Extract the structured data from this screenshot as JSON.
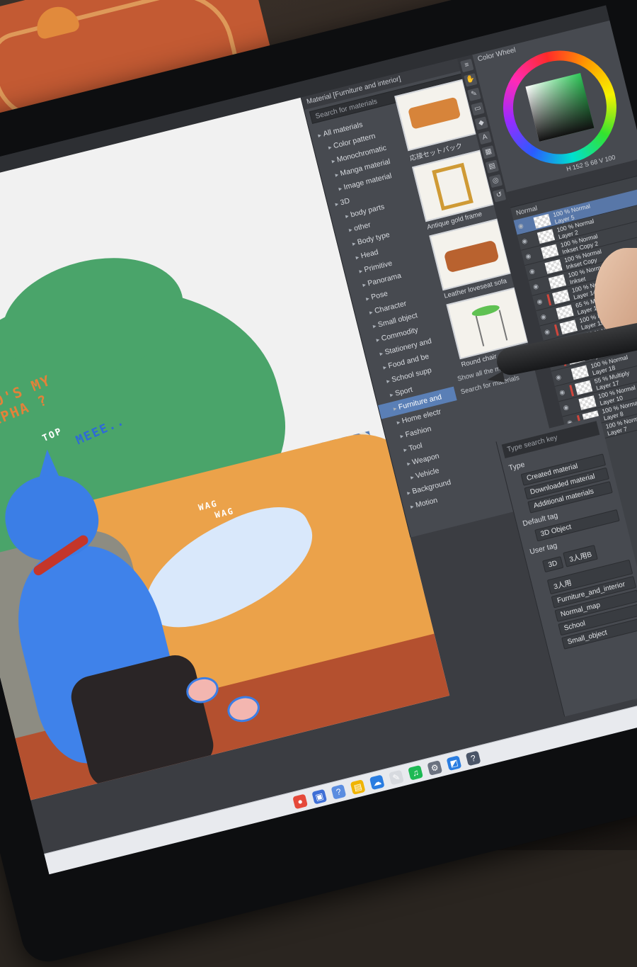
{
  "canvas_text": {
    "line1": "WHO'S MY",
    "line2": "ALPHA ?",
    "top": "TOP",
    "meee": "MEEE..",
    "wag1": "WAG",
    "wag2": "WAG"
  },
  "material_panel": {
    "title": "Material [Furniture and interior]",
    "search_placeholder": "Search for materials",
    "tree": [
      {
        "label": "All materials",
        "icon": "folder-icon",
        "level": 1,
        "selected": false
      },
      {
        "label": "Color pattern",
        "icon": "folder-icon",
        "level": 2,
        "selected": false
      },
      {
        "label": "Monochromatic",
        "icon": "folder-icon",
        "level": 2,
        "selected": false
      },
      {
        "label": "Manga material",
        "icon": "folder-icon",
        "level": 2,
        "selected": false
      },
      {
        "label": "Image material",
        "icon": "folder-icon",
        "level": 2,
        "selected": false
      },
      {
        "label": "3D",
        "icon": "folder-icon",
        "level": 1,
        "selected": false
      },
      {
        "label": "body parts",
        "icon": "folder-icon",
        "level": 2,
        "selected": false
      },
      {
        "label": "other",
        "icon": "folder-icon",
        "level": 2,
        "selected": false
      },
      {
        "label": "Body type",
        "icon": "folder-icon",
        "level": 2,
        "selected": false
      },
      {
        "label": "Head",
        "icon": "folder-icon",
        "level": 2,
        "selected": false
      },
      {
        "label": "Primitive",
        "icon": "folder-icon",
        "level": 2,
        "selected": false
      },
      {
        "label": "Panorama",
        "icon": "folder-icon",
        "level": 2,
        "selected": false
      },
      {
        "label": "Pose",
        "icon": "folder-icon",
        "level": 2,
        "selected": false
      },
      {
        "label": "Character",
        "icon": "folder-icon",
        "level": 2,
        "selected": false
      },
      {
        "label": "Small object",
        "icon": "folder-icon",
        "level": 2,
        "selected": false
      },
      {
        "label": "Commodity",
        "icon": "folder-icon",
        "level": 2,
        "selected": false
      },
      {
        "label": "Stationery and",
        "icon": "folder-icon",
        "level": 2,
        "selected": false
      },
      {
        "label": "Food and be",
        "icon": "folder-icon",
        "level": 2,
        "selected": false
      },
      {
        "label": "School supp",
        "icon": "folder-icon",
        "level": 2,
        "selected": false
      },
      {
        "label": "Sport",
        "icon": "folder-icon",
        "level": 2,
        "selected": false
      },
      {
        "label": "Furniture and",
        "icon": "folder-icon",
        "level": 2,
        "selected": true
      },
      {
        "label": "Home electr",
        "icon": "folder-icon",
        "level": 2,
        "selected": false
      },
      {
        "label": "Fashion",
        "icon": "folder-icon",
        "level": 2,
        "selected": false
      },
      {
        "label": "Tool",
        "icon": "folder-icon",
        "level": 2,
        "selected": false
      },
      {
        "label": "Weapon",
        "icon": "folder-icon",
        "level": 2,
        "selected": false
      },
      {
        "label": "Vehicle",
        "icon": "folder-icon",
        "level": 2,
        "selected": false
      },
      {
        "label": "Background",
        "icon": "folder-icon",
        "level": 1,
        "selected": false
      },
      {
        "label": "Motion",
        "icon": "folder-icon",
        "level": 1,
        "selected": false
      }
    ],
    "thumbnails": [
      {
        "label": "応接セットパック",
        "image": "sofa-sketch"
      },
      {
        "label": "Antique gold frame",
        "image": "frame"
      },
      {
        "label": "Leather loveseat sofa",
        "image": "sofa"
      },
      {
        "label": "Round chair",
        "image": "chair"
      }
    ],
    "note1": "Show all the materials in the",
    "note2": "Search for materials"
  },
  "tag_panel": {
    "search_placeholder": "Type search key",
    "type_label": "Type",
    "type_options": [
      "Created material",
      "Downloaded material",
      "Additional materials"
    ],
    "default_tag_label": "Default tag",
    "default_tags": [
      "3D Object"
    ],
    "user_tag_label": "User tag",
    "user_tags_row": [
      "3D",
      "3人用B"
    ],
    "user_tags": [
      "3人用",
      "Furniture_and_interior",
      "Normal_map",
      "School",
      "Small_object"
    ]
  },
  "color_panel": {
    "title": "Color Wheel",
    "readout": "H 152  S 68  V 100"
  },
  "layer_panel": {
    "blend_mode": "Normal",
    "layers": [
      {
        "opacity": "100 % Normal",
        "name": "Layer 5",
        "active": true,
        "flag": false
      },
      {
        "opacity": "100 % Normal",
        "name": "Layer 2",
        "active": false,
        "flag": false
      },
      {
        "opacity": "100 % Normal",
        "name": "Inkset Copy 2",
        "active": false,
        "flag": false
      },
      {
        "opacity": "100 % Normal",
        "name": "Inkset Copy",
        "active": false,
        "flag": false
      },
      {
        "opacity": "100 % Normal",
        "name": "Inkset",
        "active": false,
        "flag": false
      },
      {
        "opacity": "100 % Normal",
        "name": "Layer 14",
        "active": false,
        "flag": true
      },
      {
        "opacity": "65 % Multiply",
        "name": "Layer 13",
        "active": false,
        "flag": false
      },
      {
        "opacity": "100 % Normal",
        "name": "Layer 15",
        "active": false,
        "flag": true
      },
      {
        "opacity": "100 % Normal",
        "name": "Layer 16",
        "active": false,
        "flag": false
      },
      {
        "opacity": "49 % Multiply",
        "name": "Layer 9",
        "active": false,
        "flag": true
      },
      {
        "opacity": "100 % Normal",
        "name": "Layer 18",
        "active": false,
        "flag": false
      },
      {
        "opacity": "55 % Multiply",
        "name": "Layer 17",
        "active": false,
        "flag": true
      },
      {
        "opacity": "100 % Normal",
        "name": "Layer 10",
        "active": false,
        "flag": false
      },
      {
        "opacity": "100 % Normal",
        "name": "Layer 8",
        "active": false,
        "flag": true
      },
      {
        "opacity": "100 % Normal",
        "name": "Layer 7",
        "active": false,
        "flag": false
      }
    ]
  },
  "taskbar": {
    "icons": [
      "chrome-icon",
      "store-icon",
      "help-icon",
      "explorer-icon",
      "onedrive-icon",
      "clip-studio-icon",
      "spotify-icon",
      "settings-icon",
      "photos-icon",
      "tips-icon"
    ]
  },
  "colors": {
    "panel_bg": "#474a50",
    "selection": "#5a7fb6",
    "bush_green": "#4aa46a",
    "wolf_blue": "#3b7ee6",
    "text_orange": "#e2823a"
  }
}
